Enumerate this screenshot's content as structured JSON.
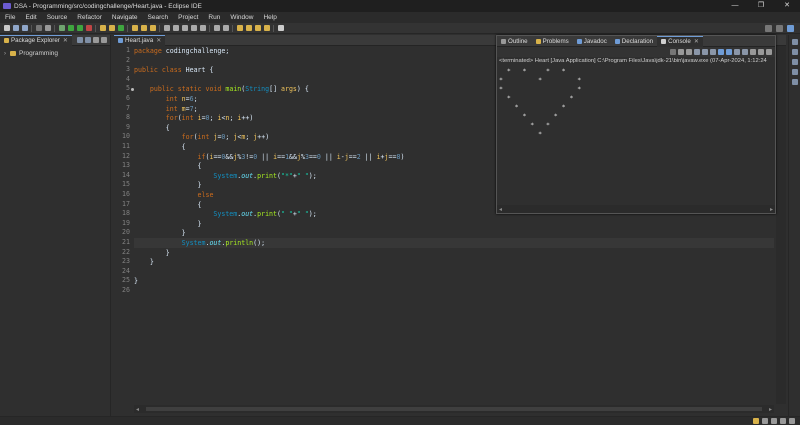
{
  "window": {
    "title": "DSA - Programming/src/codingchallenge/Heart.java - Eclipse IDE",
    "controls": [
      "—",
      "❐",
      "✕"
    ]
  },
  "menu": [
    "File",
    "Edit",
    "Source",
    "Refactor",
    "Navigate",
    "Search",
    "Project",
    "Run",
    "Window",
    "Help"
  ],
  "package_explorer": {
    "tab_label": "Package Explorer",
    "close_glyph": "✕",
    "items": [
      {
        "label": "Programming",
        "expanded": false
      }
    ]
  },
  "editor": {
    "tab_label": "Heart.java",
    "close_glyph": "✕",
    "current_line": 21,
    "line_numbers": [
      "1",
      "2",
      "3",
      "4",
      "5",
      "6",
      "7",
      "8",
      "9",
      "10",
      "11",
      "12",
      "13",
      "14",
      "15",
      "16",
      "17",
      "18",
      "19",
      "20",
      "21",
      "22",
      "23",
      "24",
      "25",
      "26"
    ],
    "code_lines": [
      "package codingchallenge;",
      "",
      "public class Heart {",
      "",
      "    public static void main(String[] args) {",
      "        int n=6;",
      "        int m=7;",
      "        for(int i=0; i<n; i++)",
      "        {",
      "            for(int j=0; j<m; j++)",
      "            {",
      "                if(i==0&&j%3!=0 || i==1&&j%3==0 || i-j==2 || i+j==8)",
      "                {",
      "                    System.out.print(\"*\"+\" \");",
      "                }",
      "                else",
      "                {",
      "                    System.out.print(\" \"+\" \");",
      "                }",
      "            }",
      "            System.out.println();",
      "        }",
      "    }",
      "",
      "}",
      ""
    ]
  },
  "console": {
    "tabs": [
      {
        "label": "Outline",
        "active": false
      },
      {
        "label": "Problems",
        "active": false
      },
      {
        "label": "Javadoc",
        "active": false
      },
      {
        "label": "Declaration",
        "active": false
      },
      {
        "label": "Console",
        "active": true
      }
    ],
    "close_glyph": "✕",
    "status": "<terminated> Heart [Java Application] C:\\Program Files\\Java\\jdk-21\\bin\\javaw.exe  (07-Apr-2024, 1:12:24",
    "output_lines": [
      "  *   *     *   *",
      "*         *         *",
      "*                   *",
      "  *               *",
      "    *           *",
      "      *       *",
      "        *   *",
      "          *"
    ]
  },
  "colors": {
    "keyword": "#cc6c1d",
    "class_name": "#1290c3",
    "variable": "#f2c55c",
    "field": "#66e1f8",
    "number": "#6897bb",
    "string": "#17c6a3",
    "method": "#a7ec21",
    "background": "#2f2f2f"
  }
}
